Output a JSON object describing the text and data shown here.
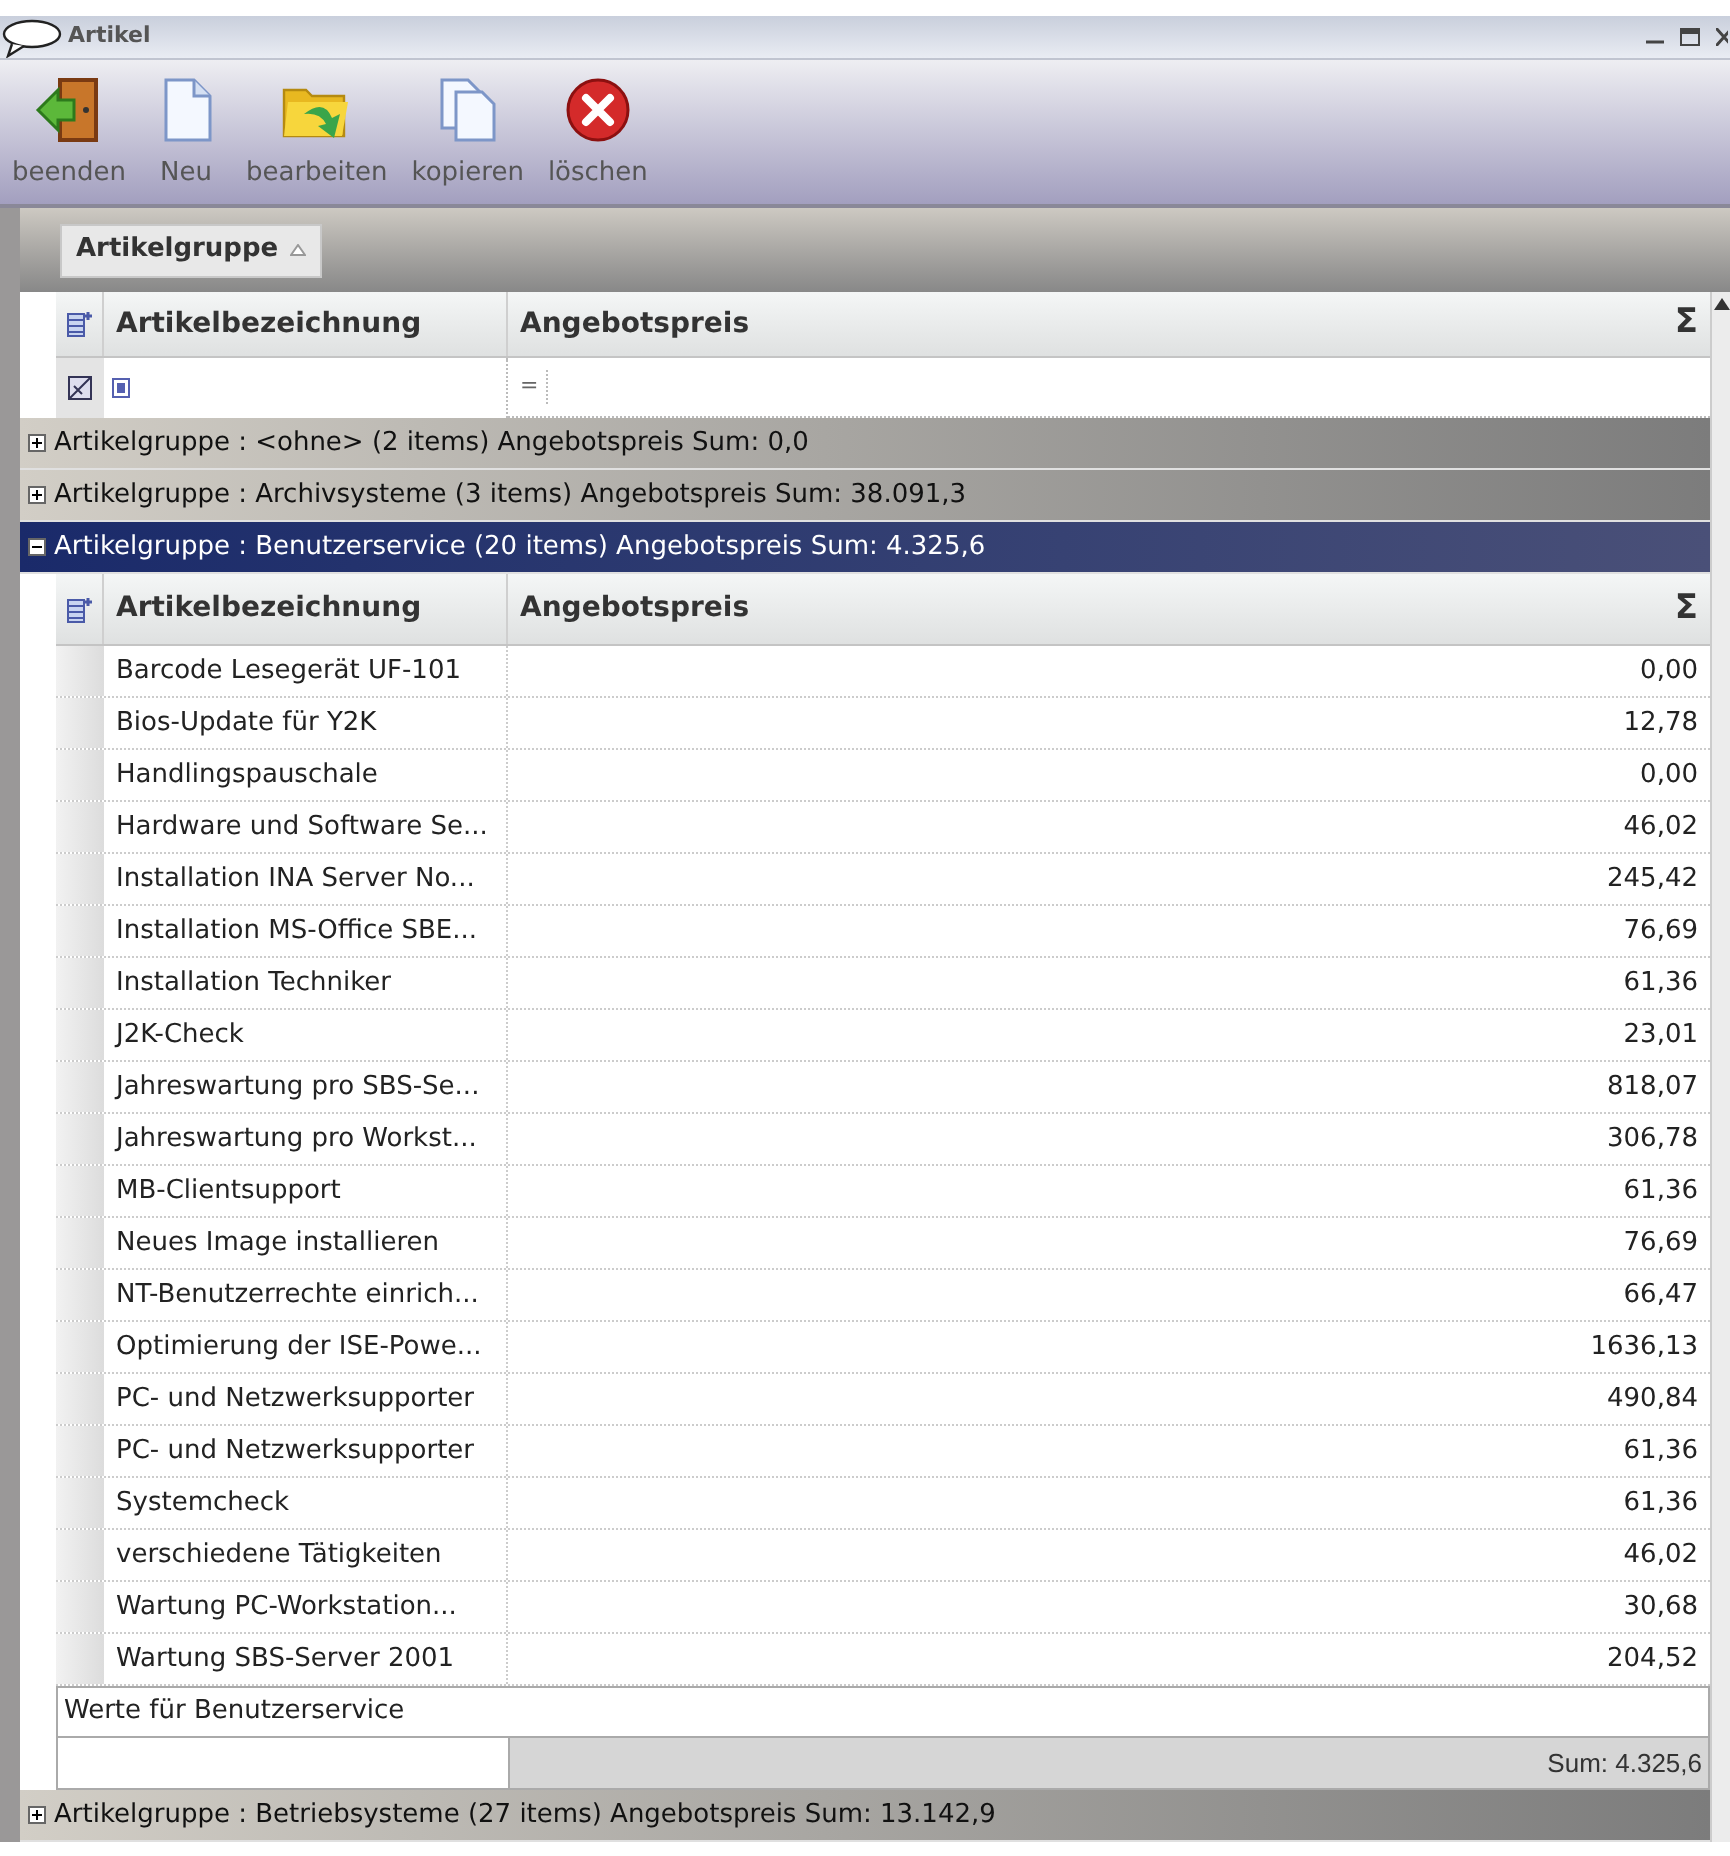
{
  "window": {
    "title": "Artikel"
  },
  "toolbar": [
    {
      "label": "beenden",
      "kind": "exit"
    },
    {
      "label": "Neu",
      "kind": "new"
    },
    {
      "label": "bearbeiten",
      "kind": "edit"
    },
    {
      "label": "kopieren",
      "kind": "copy"
    },
    {
      "label": "löschen",
      "kind": "delete"
    }
  ],
  "group_by": {
    "label": "Artikelgruppe"
  },
  "header": {
    "columns": [
      "Artikelbezeichnung",
      "Angebotspreis"
    ],
    "sum_symbol": "Σ"
  },
  "filter": {
    "operator": "="
  },
  "groups": [
    {
      "label": "Artikelgruppe : <ohne> (2 items) Angebotspreis Sum: 0,0",
      "expanded": false,
      "selected": false
    },
    {
      "label": "Artikelgruppe : Archivsysteme (3 items) Angebotspreis Sum: 38.091,3",
      "expanded": false,
      "selected": false
    },
    {
      "label": "Artikelgruppe : Benutzerservice (20 items) Angebotspreis Sum: 4.325,6",
      "expanded": true,
      "selected": true,
      "header": {
        "columns": [
          "Artikelbezeichnung",
          "Angebotspreis"
        ],
        "sum_symbol": "Σ"
      },
      "rows": [
        [
          "Barcode Lesegerät UF-101",
          "0,00"
        ],
        [
          "Bios-Update für Y2K",
          "12,78"
        ],
        [
          "Handlingspauschale",
          "0,00"
        ],
        [
          "Hardware und Software Se...",
          "46,02"
        ],
        [
          "Installation INA Server No...",
          "245,42"
        ],
        [
          "Installation MS-Office SBE...",
          "76,69"
        ],
        [
          "Installation Techniker",
          "61,36"
        ],
        [
          "J2K-Check",
          "23,01"
        ],
        [
          "Jahreswartung pro SBS-Se...",
          "818,07"
        ],
        [
          "Jahreswartung pro Workst...",
          "306,78"
        ],
        [
          "MB-Clientsupport",
          "61,36"
        ],
        [
          "Neues Image installieren",
          "76,69"
        ],
        [
          "NT-Benutzerrechte einrich...",
          "66,47"
        ],
        [
          "Optimierung der ISE-Powe...",
          "1636,13"
        ],
        [
          "PC- und Netzwerksupporter",
          "490,84"
        ],
        [
          "PC- und Netzwerksupporter",
          "61,36"
        ],
        [
          "Systemcheck",
          "61,36"
        ],
        [
          "verschiedene Tätigkeiten",
          "46,02"
        ],
        [
          "Wartung PC-Workstation...",
          "30,68"
        ],
        [
          "Wartung SBS-Server 2001",
          "204,52"
        ]
      ],
      "footer_title": "Werte für Benutzerservice",
      "footer_sum": "Sum: 4.325,6"
    },
    {
      "label": "Artikelgruppe : Betriebsysteme (27 items) Angebotspreis Sum: 13.142,9",
      "expanded": false,
      "selected": false
    }
  ]
}
